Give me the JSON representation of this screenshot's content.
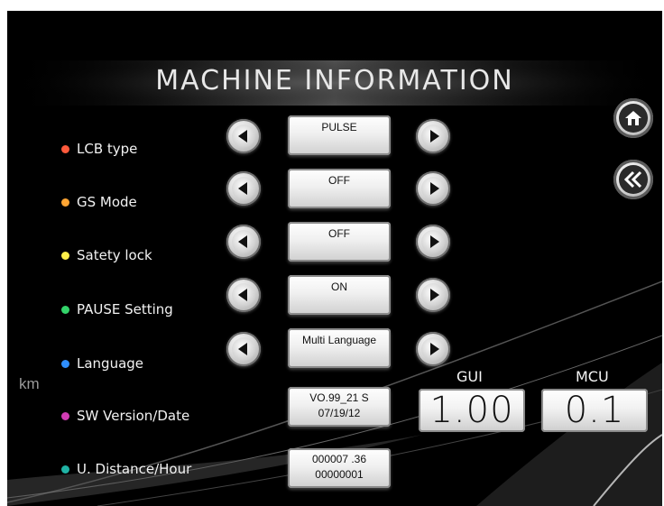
{
  "title": "MACHINE INFORMATION",
  "colors": {
    "background": "#000000",
    "dot_lcb": "#ff5a3c",
    "dot_gs": "#ffa533",
    "dot_safety": "#fff04a",
    "dot_pause": "#33d46a",
    "dot_language": "#2f8fff",
    "dot_sw": "#d23cb4",
    "dot_distance": "#20b3a5"
  },
  "settings": [
    {
      "label": "LCB type",
      "value": "PULSE"
    },
    {
      "label": "GS Mode",
      "value": "OFF"
    },
    {
      "label": "Satety lock",
      "value": "OFF"
    },
    {
      "label": "PAUSE Setting",
      "value": "ON"
    },
    {
      "label": "Language",
      "value": "Multi Language"
    }
  ],
  "info": {
    "sw_label": "SW Version/Date",
    "sw_version": "VO.99_21 S",
    "sw_date": "07/19/12",
    "distance_label": "U. Distance/Hour",
    "distance": "000007 .36",
    "hours": "00000001",
    "unit": "km"
  },
  "versions": {
    "gui_label": "GUI",
    "gui_value": "1.00",
    "mcu_label": "MCU",
    "mcu_value": "0.1"
  },
  "nav": {
    "home_icon": "home-icon",
    "back_icon": "double-chevron-left-icon"
  }
}
